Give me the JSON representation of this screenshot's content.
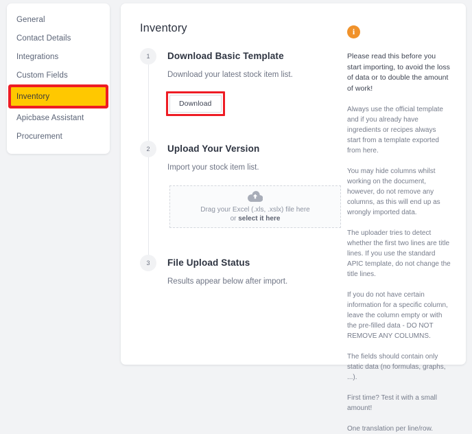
{
  "sidebar": {
    "items": [
      {
        "label": "General",
        "active": false
      },
      {
        "label": "Contact Details",
        "active": false
      },
      {
        "label": "Integrations",
        "active": false
      },
      {
        "label": "Custom Fields",
        "active": false
      },
      {
        "label": "Inventory",
        "active": true
      },
      {
        "label": "Apicbase Assistant",
        "active": false
      },
      {
        "label": "Procurement",
        "active": false
      }
    ],
    "highlight_color": "#ffc800",
    "annotation_color": "#ee1c24"
  },
  "main": {
    "title": "Inventory",
    "steps": [
      {
        "number": "1",
        "title": "Download Basic Template",
        "description": "Download your latest stock item list.",
        "button_label": "Download"
      },
      {
        "number": "2",
        "title": "Upload Your Version",
        "description": "Import your stock item list.",
        "dropzone": {
          "icon": "cloud-upload-icon",
          "line1": "Drag your Excel (.xls, .xslx) file here",
          "line2_prefix": "or ",
          "line2_link": "select it here"
        }
      },
      {
        "number": "3",
        "title": "File Upload Status",
        "description": "Results appear below after import."
      }
    ]
  },
  "info_panel": {
    "icon": "info-icon",
    "icon_glyph": "i",
    "icon_color": "#f0922b",
    "lead": "Please read this before you start importing, to avoid the loss of data or to double the amount of work!",
    "paragraphs": [
      "Always use the official template and if you already have ingredients or recipes always start from a template exported from here.",
      "You may hide columns whilst working on the document, however, do not remove any columns, as this will end up as wrongly imported data.",
      "The uploader tries to detect whether the first two lines are title lines. If you use the standard APIC template, do not change the title lines.",
      "If you do not have certain information for a specific column, leave the column empty or with the pre-filled data - DO NOT REMOVE ANY COLUMNS.",
      "The fields should contain only static data (no formulas, graphs, ...).",
      "First time? Test it with a small amount!",
      "One translation per line/row."
    ]
  }
}
